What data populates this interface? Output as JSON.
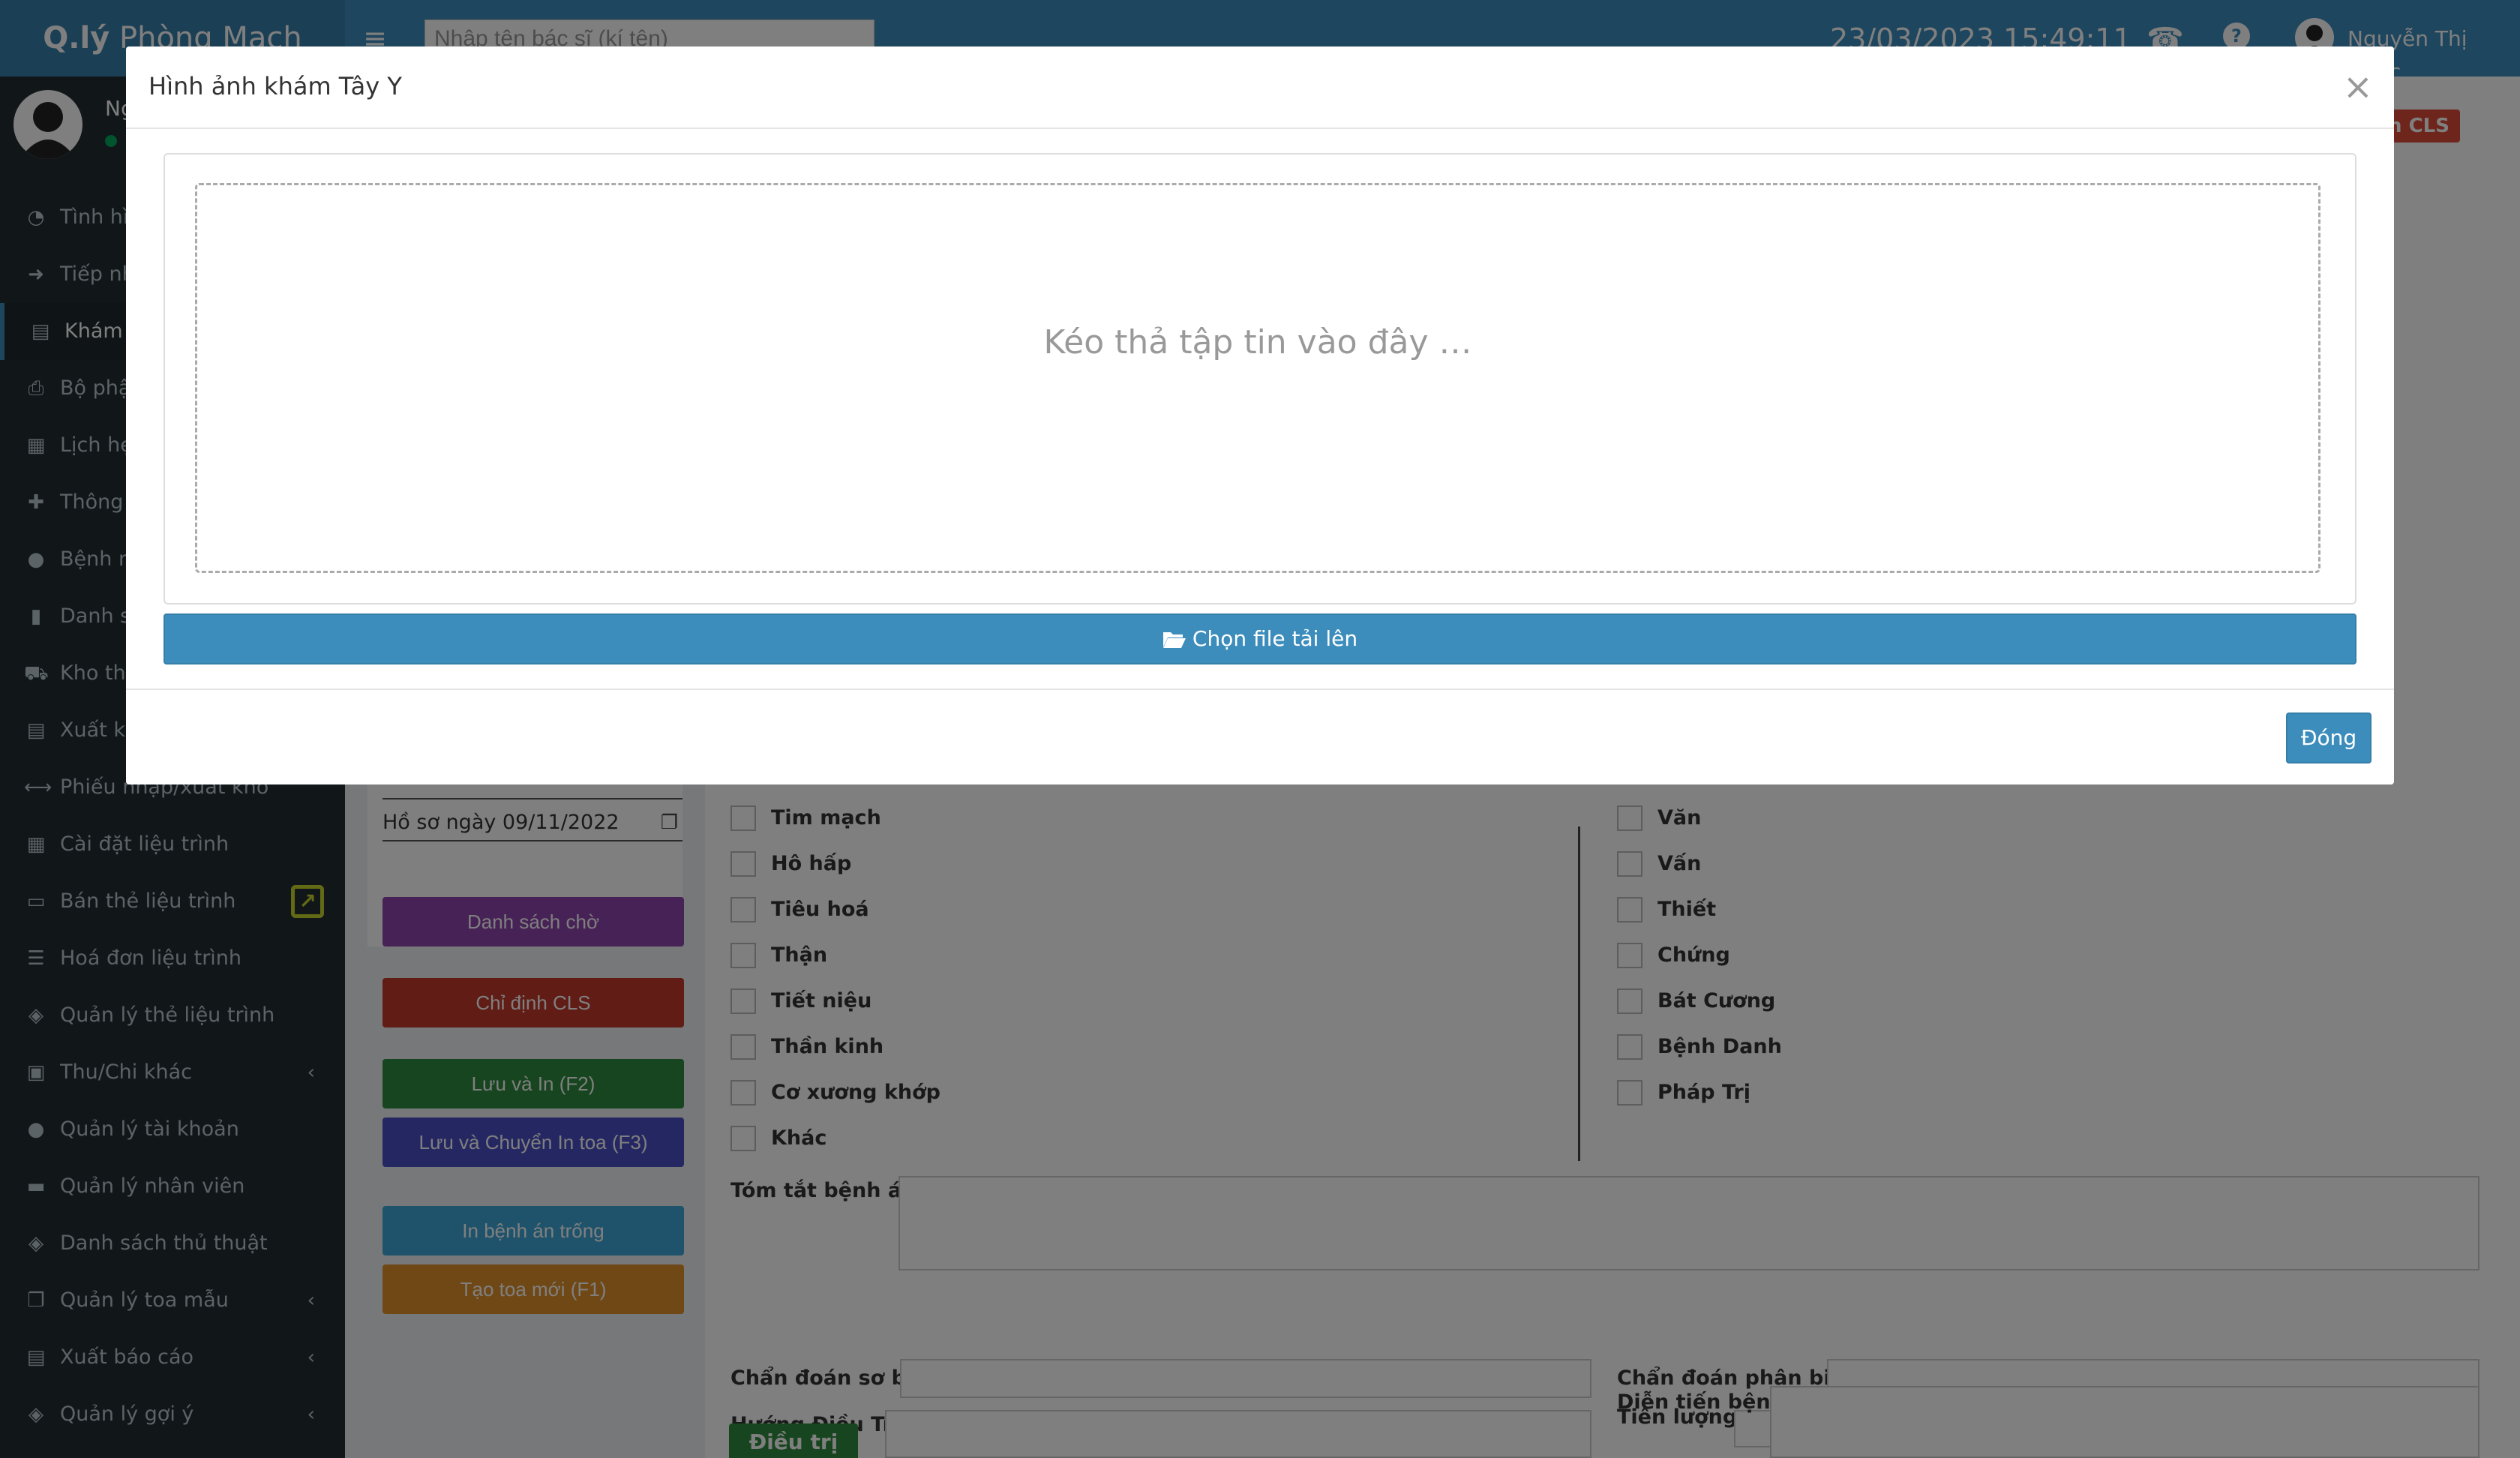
{
  "header": {
    "logo_bold": "Q.lý",
    "logo_light": " Phòng Mạch",
    "search_placeholder": "Nhập tên bác sĩ (kí tên)",
    "datetime": "23/03/2023  15:49:11",
    "user_name": "Nguyễn Thị Ngọc"
  },
  "sidebar": {
    "user_name": "Ng",
    "items": [
      {
        "label": "Tình hì",
        "icon": "pie-chart-icon"
      },
      {
        "label": "Tiếp nh",
        "icon": "sign-in-icon"
      },
      {
        "label": "Khám b",
        "icon": "clipboard-icon"
      },
      {
        "label": "Bộ phậ",
        "icon": "print-icon"
      },
      {
        "label": "Lịch hẹ",
        "icon": "calendar-icon"
      },
      {
        "label": "Thông t",
        "icon": "plus-icon"
      },
      {
        "label": "Bệnh nl",
        "icon": "user-icon"
      },
      {
        "label": "Danh sá",
        "icon": "file-icon"
      },
      {
        "label": "Kho thu",
        "icon": "truck-icon"
      },
      {
        "label": "Xuất kh",
        "icon": "clipboard-icon"
      },
      {
        "label": "Phiếu nhập/xuất kho",
        "icon": "arrows-h-icon"
      },
      {
        "label": "Cài đặt liệu trình",
        "icon": "table-icon"
      },
      {
        "label": "Bán thẻ liệu trình",
        "icon": "credit-card-icon"
      },
      {
        "label": "Hoá đơn liệu trình",
        "icon": "list-icon"
      },
      {
        "label": "Quản lý thẻ liệu trình",
        "icon": "tags-icon"
      },
      {
        "label": "Thu/Chi khác",
        "icon": "money-icon"
      },
      {
        "label": "Quản lý tài khoản",
        "icon": "users-icon"
      },
      {
        "label": "Quản lý nhân viên",
        "icon": "briefcase-icon"
      },
      {
        "label": "Danh sách thủ thuật",
        "icon": "tags-icon"
      },
      {
        "label": "Quản lý toa mẫu",
        "icon": "copy-icon"
      },
      {
        "label": "Xuất báo cáo",
        "icon": "file-export-icon"
      },
      {
        "label": "Quản lý gợi ý",
        "icon": "tags-icon"
      }
    ]
  },
  "content": {
    "record_date": "Hồ sơ ngày 09/11/2022",
    "badge": "h CLS",
    "buttons": {
      "waiting_list": "Danh sách chờ",
      "cls": "Chỉ định CLS",
      "save_print": "Lưu và In (F2)",
      "save_transfer": "Lưu và Chuyển In toa (F3)",
      "print_blank": "In bệnh án trống",
      "new_prescription": "Tạo toa mới (F1)",
      "treatment": "Điều trị"
    },
    "colors": {
      "purple": "#8e44ad",
      "red": "#c0392b",
      "green": "#2e8b3e",
      "indigo": "#4b4fc4",
      "cyan": "#3fa7d6",
      "orange": "#e0902a"
    },
    "checkboxes_left": [
      "Tim mạch",
      "Hô hấp",
      "Tiêu hoá",
      "Thận",
      "Tiết niệu",
      "Thần kinh",
      "Cơ xương khớp",
      "Khác"
    ],
    "checkboxes_right": [
      "Văn",
      "Vấn",
      "Thiết",
      "Chứng",
      "Bát Cương",
      "Bệnh Danh",
      "Pháp Trị"
    ],
    "labels": {
      "summary": "Tóm tắt bệnh án:",
      "prelim_diag": "Chẩn đoán sơ bộ:",
      "diff_diag": "Chẩn đoán phân biệt:",
      "treatment_dir": "Hướng Điều Trị:",
      "prognosis": "Tiên lượng:",
      "progress": "Diễn tiến bệnh:"
    }
  },
  "modal": {
    "title": "Hình ảnh khám Tây Y",
    "close_symbol": "×",
    "drop_text": "Kéo thả tập tin vào đây …",
    "choose_file": "Chọn file tải lên",
    "close_button": "Đóng"
  }
}
